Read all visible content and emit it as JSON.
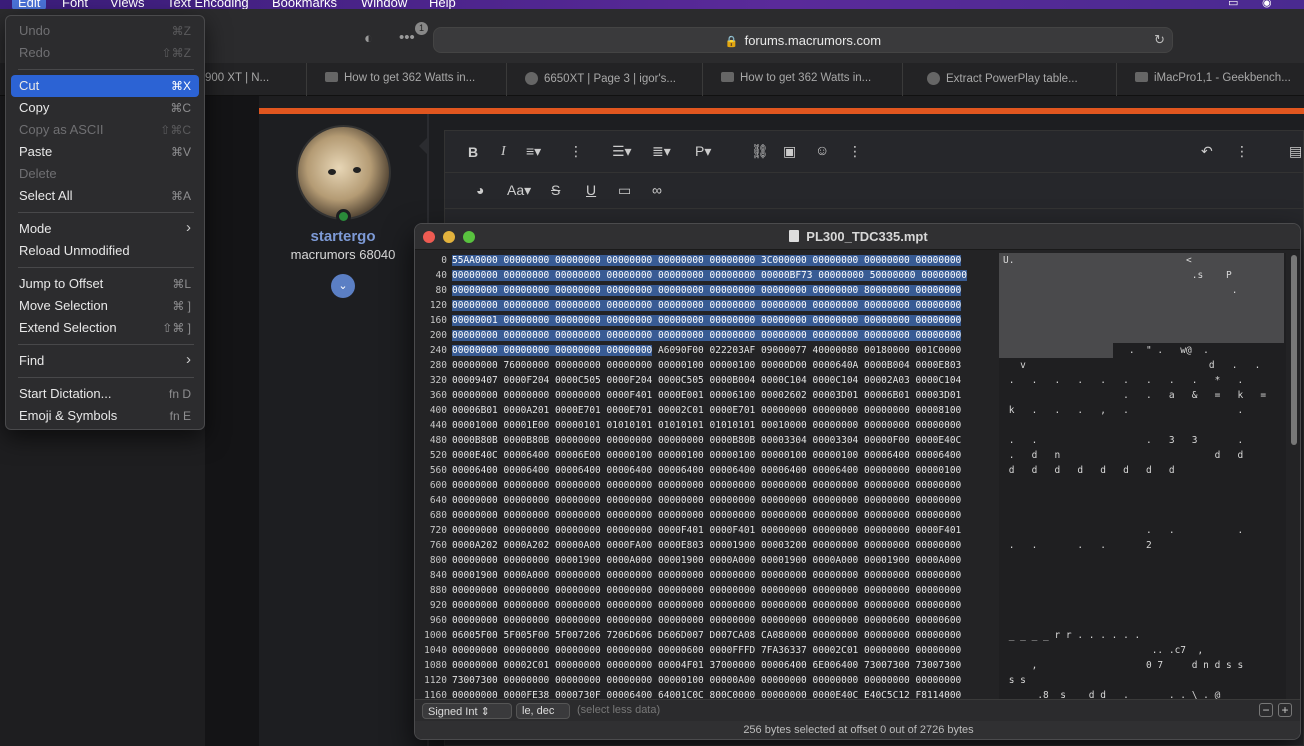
{
  "menubar": {
    "items": [
      "Edit",
      "Font",
      "Views",
      "Text Encoding",
      "Bookmarks",
      "Window",
      "Help"
    ]
  },
  "browser": {
    "url": "forums.macrumors.com",
    "badge_count": "1",
    "tabs": [
      {
        "title": "900 XT | N..."
      },
      {
        "title": "How to get 362 Watts in..."
      },
      {
        "title": "6650XT | Page 3 | igor's..."
      },
      {
        "title": "How to get 362 Watts in..."
      },
      {
        "title": "Extract PowerPlay table..."
      },
      {
        "title": "iMacPro1,1 - Geekbench..."
      }
    ]
  },
  "forum": {
    "username": "startergo",
    "user_title": "macrumors 68040",
    "accent": "#e0561f"
  },
  "edit_menu": {
    "items": [
      {
        "label": "Undo",
        "shortcut": "⌘Z"
      },
      {
        "label": "Redo",
        "shortcut": "⇧⌘Z"
      },
      {
        "label": "Cut",
        "shortcut": "⌘X"
      },
      {
        "label": "Copy",
        "shortcut": "⌘C"
      },
      {
        "label": "Copy as ASCII",
        "shortcut": "⇧⌘C"
      },
      {
        "label": "Paste",
        "shortcut": "⌘V"
      },
      {
        "label": "Delete",
        "shortcut": ""
      },
      {
        "label": "Select All",
        "shortcut": "⌘A"
      },
      {
        "label": "Mode",
        "shortcut": "›"
      },
      {
        "label": "Reload Unmodified",
        "shortcut": ""
      },
      {
        "label": "Jump to Offset",
        "shortcut": "⌘L"
      },
      {
        "label": "Move Selection",
        "shortcut": "⌘ ]"
      },
      {
        "label": "Extend Selection",
        "shortcut": "⇧⌘ ]"
      },
      {
        "label": "Find",
        "shortcut": "›"
      },
      {
        "label": "Start Dictation...",
        "shortcut": "fn D"
      },
      {
        "label": "Emoji & Symbols",
        "shortcut": "fn E"
      }
    ]
  },
  "hex_window": {
    "title": "PL300_TDC335.mpt",
    "offsets": [
      "0",
      "40",
      "80",
      "120",
      "160",
      "200",
      "240",
      "280",
      "320",
      "360",
      "400",
      "440",
      "480",
      "520",
      "560",
      "600",
      "640",
      "680",
      "720",
      "760",
      "800",
      "840",
      "880",
      "920",
      "960",
      "1000",
      "1040",
      "1080",
      "1120",
      "1160"
    ],
    "rows": [
      [
        "55AA0000",
        "00000000",
        "00000000",
        "00000000",
        "00000000",
        "00000000",
        "3C000000",
        "00000000",
        "00000000",
        "00000000"
      ],
      [
        "00000000",
        "00000000",
        "00000000",
        "00000000",
        "00000000",
        "00000000",
        "00000BF73",
        "00000000",
        "50000000",
        "00000000"
      ],
      [
        "00000000",
        "00000000",
        "00000000",
        "00000000",
        "00000000",
        "00000000",
        "00000000",
        "00000000",
        "80000000",
        "00000000"
      ],
      [
        "00000000",
        "00000000",
        "00000000",
        "00000000",
        "00000000",
        "00000000",
        "00000000",
        "00000000",
        "00000000",
        "00000000"
      ],
      [
        "00000001",
        "00000000",
        "00000000",
        "00000000",
        "00000000",
        "00000000",
        "00000000",
        "00000000",
        "00000000",
        "00000000"
      ],
      [
        "00000000",
        "00000000",
        "00000000",
        "00000000",
        "00000000",
        "00000000",
        "00000000",
        "00000000",
        "00000000",
        "00000000"
      ],
      [
        "00000000",
        "00000000",
        "00000000",
        "00000000",
        "A6090F00",
        "022203AF",
        "09000077",
        "40000080",
        "00180000",
        "001C0000"
      ],
      [
        "00000000",
        "76000000",
        "00000000",
        "00000000",
        "00000100",
        "00000100",
        "00000D00",
        "0000640A",
        "0000B004",
        "0000E803"
      ],
      [
        "00009407",
        "0000F204",
        "0000C505",
        "0000F204",
        "0000C505",
        "0000B004",
        "0000C104",
        "0000C104",
        "00002A03",
        "0000C104"
      ],
      [
        "00000000",
        "00000000",
        "00000000",
        "0000F401",
        "0000E001",
        "00006100",
        "00002602",
        "00003D01",
        "00006B01",
        "00003D01"
      ],
      [
        "00006B01",
        "0000A201",
        "0000E701",
        "0000E701",
        "00002C01",
        "0000E701",
        "00000000",
        "00000000",
        "00000000",
        "00008100"
      ],
      [
        "00001000",
        "00001E00",
        "00000101",
        "01010101",
        "01010101",
        "01010101",
        "00010000",
        "00000000",
        "00000000",
        "00000000"
      ],
      [
        "0000B80B",
        "0000B80B",
        "00000000",
        "00000000",
        "00000000",
        "0000B80B",
        "00003304",
        "00003304",
        "00000F00",
        "0000E40C"
      ],
      [
        "0000E40C",
        "00006400",
        "00006E00",
        "00000100",
        "00000100",
        "00000100",
        "00000100",
        "00000100",
        "00006400",
        "00006400"
      ],
      [
        "00006400",
        "00006400",
        "00006400",
        "00006400",
        "00006400",
        "00006400",
        "00006400",
        "00006400",
        "00000000",
        "00000100"
      ],
      [
        "00000000",
        "00000000",
        "00000000",
        "00000000",
        "00000000",
        "00000000",
        "00000000",
        "00000000",
        "00000000",
        "00000000"
      ],
      [
        "00000000",
        "00000000",
        "00000000",
        "00000000",
        "00000000",
        "00000000",
        "00000000",
        "00000000",
        "00000000",
        "00000000"
      ],
      [
        "00000000",
        "00000000",
        "00000000",
        "00000000",
        "00000000",
        "00000000",
        "00000000",
        "00000000",
        "00000000",
        "00000000"
      ],
      [
        "00000000",
        "00000000",
        "00000000",
        "00000000",
        "0000F401",
        "0000F401",
        "00000000",
        "00000000",
        "00000000",
        "0000F401"
      ],
      [
        "0000A202",
        "0000A202",
        "00000A00",
        "0000FA00",
        "0000E803",
        "00001900",
        "00003200",
        "00000000",
        "00000000",
        "00000000"
      ],
      [
        "00000000",
        "00000000",
        "00001900",
        "0000A000",
        "00001900",
        "0000A000",
        "00001900",
        "0000A000",
        "00001900",
        "0000A000"
      ],
      [
        "00001900",
        "0000A000",
        "00000000",
        "00000000",
        "00000000",
        "00000000",
        "00000000",
        "00000000",
        "00000000",
        "00000000"
      ],
      [
        "00000000",
        "00000000",
        "00000000",
        "00000000",
        "00000000",
        "00000000",
        "00000000",
        "00000000",
        "00000000",
        "00000000"
      ],
      [
        "00000000",
        "00000000",
        "00000000",
        "00000000",
        "00000000",
        "00000000",
        "00000000",
        "00000000",
        "00000000",
        "00000000"
      ],
      [
        "00000000",
        "00000000",
        "00000000",
        "00000000",
        "00000000",
        "00000000",
        "00000000",
        "00000000",
        "00000600",
        "00000600"
      ],
      [
        "06005F00",
        "5F005F00",
        "5F007206",
        "7206D606",
        "D606D007",
        "D007CA08",
        "CA080000",
        "00000000",
        "00000000",
        "00000000"
      ],
      [
        "00000000",
        "00000000",
        "00000000",
        "00000000",
        "00000600",
        "0000FFFD",
        "7FA36337",
        "00002C01",
        "00000000",
        "00000000"
      ],
      [
        "00000000",
        "00002C01",
        "00000000",
        "00000000",
        "00004F01",
        "37000000",
        "00006400",
        "6E006400",
        "73007300",
        "73007300"
      ],
      [
        "73007300",
        "00000000",
        "00000000",
        "00000000",
        "00000100",
        "00000A00",
        "00000000",
        "00000000",
        "00000000",
        "00000000"
      ],
      [
        "00000000",
        "0000FE38",
        "0000730F",
        "00006400",
        "64001C0C",
        "800C0000",
        "00000000",
        "0000E40C",
        "E40C5C12",
        "F8114000"
      ]
    ],
    "ascii": [
      "U.                              <",
      "                                 .s    P",
      "                                        .",
      "",
      "",
      "",
      "                      .  \" .   w@  .",
      "   v                                d   .   .",
      " .   .   .   .   .   .   .   .   .   *   .",
      "                     .   .   a   &   =   k   =",
      " k   .   .   .   ,   .                   .",
      "",
      " .   .                   .   3   3       .",
      " .   d   n                           d   d",
      " d   d   d   d   d   d   d   d",
      "",
      "",
      "",
      "                         .   .           .",
      " .   .       .   .       2",
      "",
      "",
      "",
      "",
      "",
      " _ _ _ _ r r . . . . . .",
      "                          .. .c7  ,",
      "     ,                   0 7     d n d s s",
      " s s",
      "      .8  s    d d   .       . . \\ . @"
    ],
    "type_select": "Signed Int",
    "endian_select": "le, dec",
    "less_data_hint": "(select less data)",
    "status": "256 bytes selected at offset 0 out of 2726 bytes"
  }
}
